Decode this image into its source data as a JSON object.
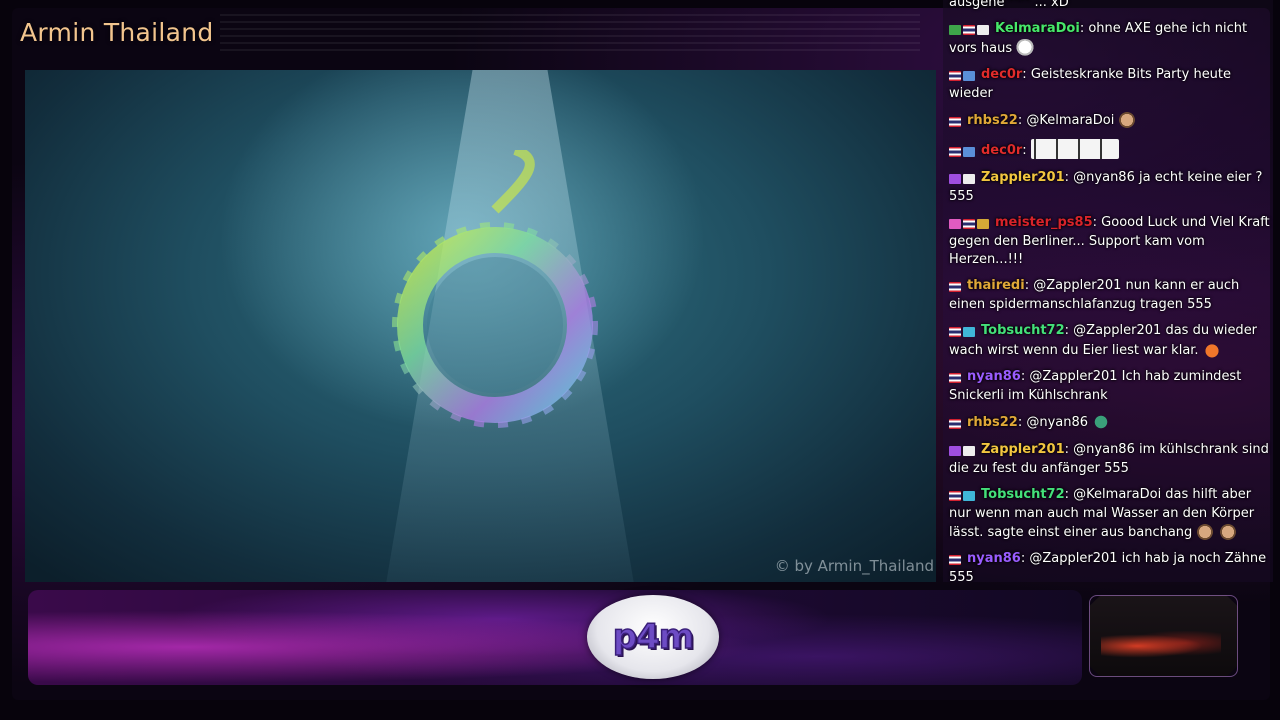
{
  "overlay": {
    "channel_title": "Armin Thailand",
    "logo_text": "p4m"
  },
  "video": {
    "watermark": "© by Armin_Thailand"
  },
  "chat": {
    "messages": [
      {
        "user": "",
        "text": "ausgehe ^^ ... xD",
        "color": "#ffffff",
        "badges": [],
        "emotes": []
      },
      {
        "user": "KelmaraDoi",
        "sep": ":",
        "text": "ohne AXE gehe ich nicht vors haus",
        "color": "#47e86a",
        "badges": [
          "green-badge",
          "thai-flag",
          "video-badge"
        ],
        "emotes": [
          "ghost-emote"
        ]
      },
      {
        "user": "dec0r",
        "sep": ":",
        "text": "Geisteskranke Bits Party heute wieder",
        "color": "#e02b2b",
        "badges": [
          "thai-flag",
          "gift-badge"
        ],
        "emotes": []
      },
      {
        "user": "rhbs22",
        "sep": ":",
        "text": "@KelmaraDoi",
        "color": "#e0a838",
        "badges": [
          "thai-flag"
        ],
        "emotes": [
          "face-emote"
        ]
      },
      {
        "user": "dec0r",
        "sep": ":",
        "text": "",
        "color": "#e02b2b",
        "badges": [
          "thai-flag",
          "gift-badge"
        ],
        "emotes": [
          "penguin-emote-strip"
        ]
      },
      {
        "user": "Zappler201",
        "sep": ":",
        "text": "@nyan86 ja echt keine eier ? 555",
        "color": "#f2c640",
        "badges": [
          "bits-badge",
          "video-badge"
        ],
        "emotes": []
      },
      {
        "user": "meister_ps85",
        "sep": ":",
        "text": "Goood Luck und Viel Kraft gegen den Berliner... Support kam vom Herzen...!!!",
        "color": "#d8232a",
        "badges": [
          "heart-badge",
          "thai-flag",
          "crown-badge"
        ],
        "emotes": []
      },
      {
        "user": "thairedi",
        "sep": ":",
        "text": "@Zappler201 nun kann er auch einen spidermanschlafanzug tragen 555",
        "color": "#e0a838",
        "badges": [
          "thai-flag"
        ],
        "emotes": []
      },
      {
        "user": "Tobsucht72",
        "sep": ":",
        "text": "@Zappler201 das du wieder wach wirst wenn du Eier liest war klar.",
        "color": "#44e07a",
        "badges": [
          "thai-flag",
          "sub-badge"
        ],
        "emotes": [
          "chick-emote"
        ]
      },
      {
        "user": "nyan86",
        "sep": ":",
        "text": "@Zappler201 Ich hab zumindest Snickerli im Kühlschrank",
        "color": "#9a5cff",
        "badges": [
          "thai-flag"
        ],
        "emotes": []
      },
      {
        "user": "rhbs22",
        "sep": ":",
        "text": "@nyan86",
        "color": "#e0a838",
        "badges": [
          "thai-flag"
        ],
        "emotes": [
          "green-emote"
        ]
      },
      {
        "user": "Zappler201",
        "sep": ":",
        "text": "@nyan86 im kühlschrank sind die zu fest du anfänger 555",
        "color": "#f2c640",
        "badges": [
          "bits-badge",
          "video-badge"
        ],
        "emotes": []
      },
      {
        "user": "Tobsucht72",
        "sep": ":",
        "text": "@KelmaraDoi das hilft aber nur wenn man auch mal Wasser an den Körper lässt. sagte einst einer aus banchang",
        "color": "#44e07a",
        "badges": [
          "thai-flag",
          "sub-badge"
        ],
        "emotes": [
          "face-emote",
          "face-emote"
        ]
      },
      {
        "user": "nyan86",
        "sep": ":",
        "text": "@Zappler201 ich hab ja noch Zähne 555",
        "color": "#9a5cff",
        "badges": [
          "thai-flag"
        ],
        "emotes": []
      }
    ]
  }
}
